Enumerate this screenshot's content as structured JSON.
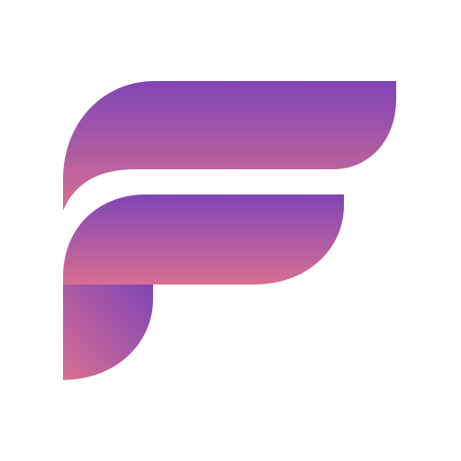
{
  "logo": {
    "icon": "stylized-letter-f-logo",
    "colors": {
      "background": "#ffffff",
      "gradient_top": "#7f45b6",
      "gradient_bottom": "#d86f92"
    }
  }
}
